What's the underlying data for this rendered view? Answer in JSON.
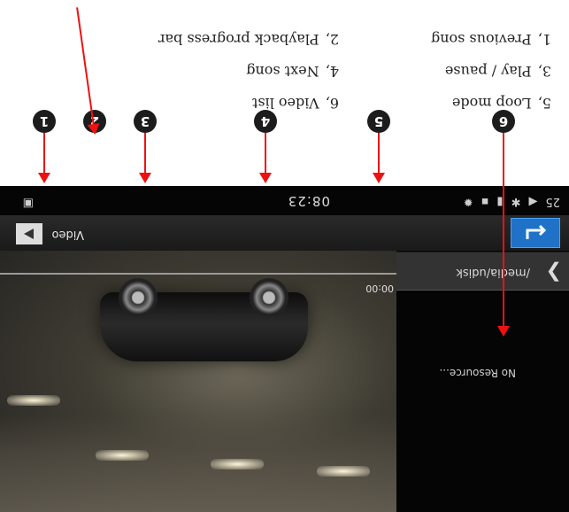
{
  "legend": {
    "left": [
      {
        "num": "1,",
        "label": "Previous song"
      },
      {
        "num": "3,",
        "label": "Play / pause"
      },
      {
        "num": "5,",
        "label": "Loop mode"
      }
    ],
    "right": [
      {
        "num": "2,",
        "label": "Playback progress bar"
      },
      {
        "num": "4,",
        "label": "Next song"
      },
      {
        "num": "6,",
        "label": "Video list"
      }
    ]
  },
  "callouts": [
    "1",
    "2",
    "3",
    "4",
    "5",
    "6"
  ],
  "statusbar": {
    "time": "08:23",
    "left_icons": [
      "25",
      "volume-icon",
      "bluetooth-icon",
      "battery-icon",
      "signal-icon",
      "brightness-icon"
    ],
    "right_icon": "image-icon"
  },
  "titlebar": {
    "title": "Video",
    "back_icon": "back-arrow-icon",
    "app_icon": "video-icon"
  },
  "file_panel": {
    "path": "/media/udisk",
    "empty_text": "No Resource..."
  },
  "player": {
    "duration": "00:00",
    "progress": 0
  },
  "colors": {
    "accent": "#1f72c8",
    "callout_arrow": "#ee1111",
    "badge": "#1c1c1c"
  }
}
